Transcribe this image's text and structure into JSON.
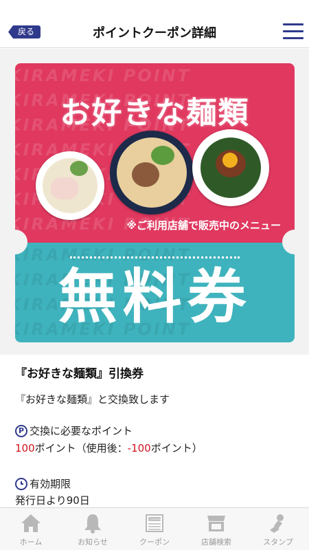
{
  "header": {
    "back_label": "戻る",
    "title": "ポイントクーポン詳細"
  },
  "coupon_banner": {
    "background_word": "KIRAMEKI POINT",
    "heading": "お好きな麺類",
    "note": "※ご利用店舗で販売中のメニュー",
    "free_label": "無料券",
    "colors": {
      "top": "#e0385f",
      "bottom": "#3fb3bd"
    }
  },
  "detail": {
    "title": "『お好きな麺類』引換券",
    "description": "『お好きな麺類』と交換致します",
    "points_label": "交換に必要なポイント",
    "points_value": "100",
    "points_unit": "ポイント（使用後：",
    "points_after": "-100",
    "points_after_unit": "ポイント）",
    "validity_label": "有効期限",
    "validity_value": "発行日より90日"
  },
  "tabs": [
    {
      "label": "ホーム",
      "icon": "home-icon"
    },
    {
      "label": "お知らせ",
      "icon": "bell-icon"
    },
    {
      "label": "クーポン",
      "icon": "coupon-icon",
      "icon_text": "COUPON"
    },
    {
      "label": "店舗検索",
      "icon": "store-icon"
    },
    {
      "label": "スタンプ",
      "icon": "stamp-icon"
    }
  ],
  "accent_color": "#2f3a8c",
  "highlight_color": "#d0141e"
}
